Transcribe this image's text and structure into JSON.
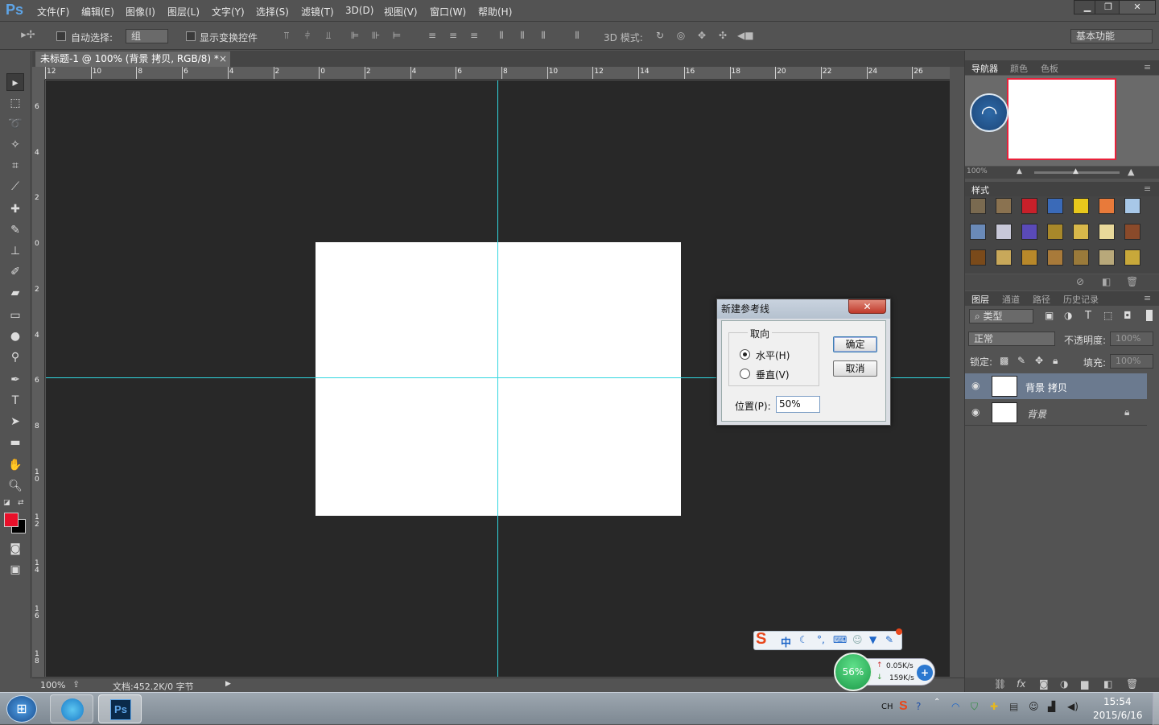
{
  "app": {
    "logo": "Ps"
  },
  "menu": [
    "文件(F)",
    "编辑(E)",
    "图像(I)",
    "图层(L)",
    "文字(Y)",
    "选择(S)",
    "滤镜(T)",
    "3D(D)",
    "视图(V)",
    "窗口(W)",
    "帮助(H)"
  ],
  "window_controls": {
    "minimize": "▁",
    "restore": "❐",
    "close": "✕"
  },
  "options": {
    "auto_select_label": "自动选择:",
    "auto_select_value": "组",
    "show_transform_label": "显示变换控件",
    "mode_3d_label": "3D 模式:",
    "workspace": "基本功能"
  },
  "document": {
    "tab_title": "未标题-1 @ 100% (背景 拷贝, RGB/8) *",
    "tab_close": "×",
    "zoom": "100%",
    "doc_info": "文档:452.2K/0 字节"
  },
  "ruler_top": [
    "12",
    "10",
    "8",
    "6",
    "4",
    "2",
    "0",
    "2",
    "4",
    "6",
    "8",
    "10",
    "12",
    "14",
    "16",
    "18",
    "20",
    "22",
    "24",
    "26"
  ],
  "ruler_left": [
    "6",
    "4",
    "2",
    "0",
    "2",
    "4",
    "6",
    "8",
    "1 0",
    "1 2",
    "1 4",
    "1 6",
    "1 8"
  ],
  "navigator": {
    "tabs": [
      "导航器",
      "颜色",
      "色板"
    ],
    "zoom": "100%"
  },
  "styles": {
    "tab": "样式"
  },
  "layers": {
    "tabs": [
      "图层",
      "通道",
      "路径",
      "历史记录"
    ],
    "filter_label": "类型",
    "blend_mode": "正常",
    "opacity_label": "不透明度:",
    "opacity_value": "100%",
    "lock_label": "锁定:",
    "fill_label": "填充:",
    "fill_value": "100%",
    "items": [
      {
        "name": "背景 拷贝",
        "selected": true
      },
      {
        "name": "背景",
        "selected": false
      }
    ]
  },
  "dialog": {
    "title": "新建参考线",
    "close": "✕",
    "group_label": "取向",
    "horizontal_label": "水平(H)",
    "vertical_label": "垂直(V)",
    "position_label": "位置(P):",
    "position_value": "50%",
    "ok_label": "确定",
    "cancel_label": "取消"
  },
  "widgets": {
    "ime_label": "中",
    "net_percent": "56%",
    "upload": "0.05K/s",
    "download": "159K/s"
  },
  "taskbar": {
    "lang": "CH",
    "time": "15:54",
    "date": "2015/6/16"
  },
  "colors": {
    "guide": "#32d6e0",
    "foreground": "#e8102a",
    "accent": "#5ea5e8"
  }
}
